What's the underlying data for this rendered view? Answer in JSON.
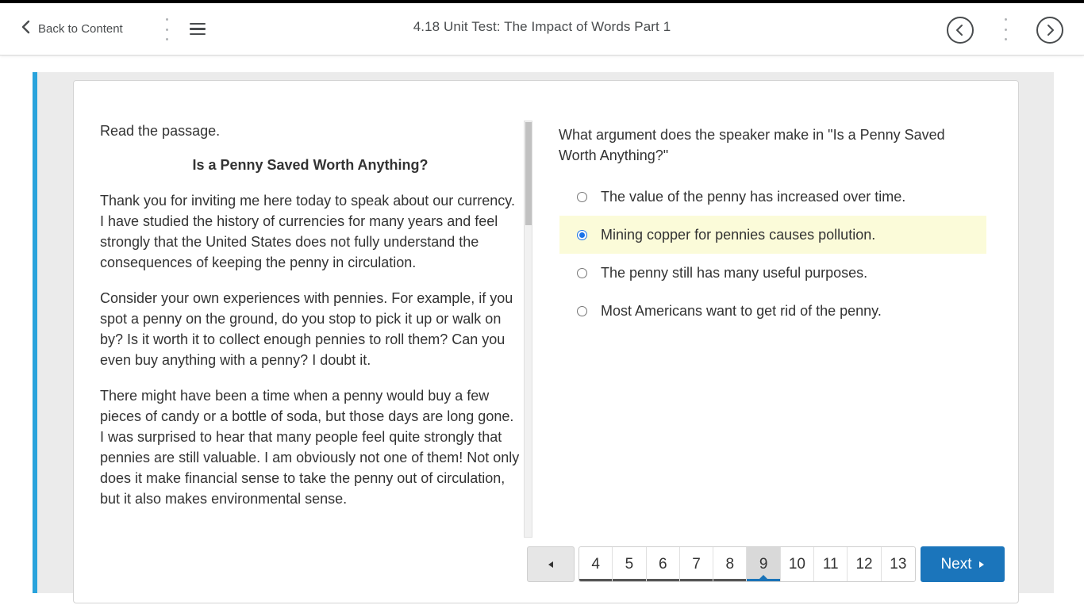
{
  "header": {
    "back_label": "Back to Content",
    "title": "4.18 Unit Test: The Impact of Words Part 1"
  },
  "passage": {
    "intro": "Read the passage.",
    "heading": "Is a Penny Saved Worth Anything?",
    "paragraphs": [
      "Thank you for inviting me here today to speak about our currency. I have studied the history of currencies for many years and feel strongly that the United States does not fully understand the consequences of keeping the penny in circulation.",
      "Consider your own experiences with pennies. For example, if you spot a penny on the ground, do you stop to pick it up or walk on by? Is it worth it to collect enough pennies to roll them? Can you even buy anything with a penny? I doubt it.",
      "There might have been a time when a penny would buy a few pieces of candy or a bottle of soda, but those days are long gone. I was surprised to hear that many people feel quite strongly that pennies are still valuable. I am obviously not one of them! Not only does it make financial sense to take the penny out of circulation, but it also makes environmental sense."
    ]
  },
  "question": {
    "prompt": "What argument does the speaker make in \"Is a Penny Saved Worth Anything?\"",
    "options": [
      "The value of the penny has increased over time.",
      "Mining copper for pennies causes pollution.",
      "The penny still has many useful purposes.",
      "Most Americans want to get rid of the penny."
    ],
    "selected_option": "Mining copper for pennies causes pollution."
  },
  "pager": {
    "prev_glyph": "◄",
    "pages": [
      "4",
      "5",
      "6",
      "7",
      "8",
      "9",
      "10",
      "11",
      "12",
      "13"
    ],
    "current_page": "9",
    "next_label": "Next"
  },
  "colors": {
    "accent": "#29a3dc",
    "primary_button": "#1b75bb",
    "selected_option_bg": "#fbfbd9"
  },
  "icons": {
    "back": "chevron-left-icon",
    "menu": "hamburger-menu-icon",
    "prev": "circle-chevron-left-icon",
    "next": "circle-chevron-right-icon",
    "pager_prev": "triangle-left-icon",
    "next_button": "triangle-right-icon"
  }
}
